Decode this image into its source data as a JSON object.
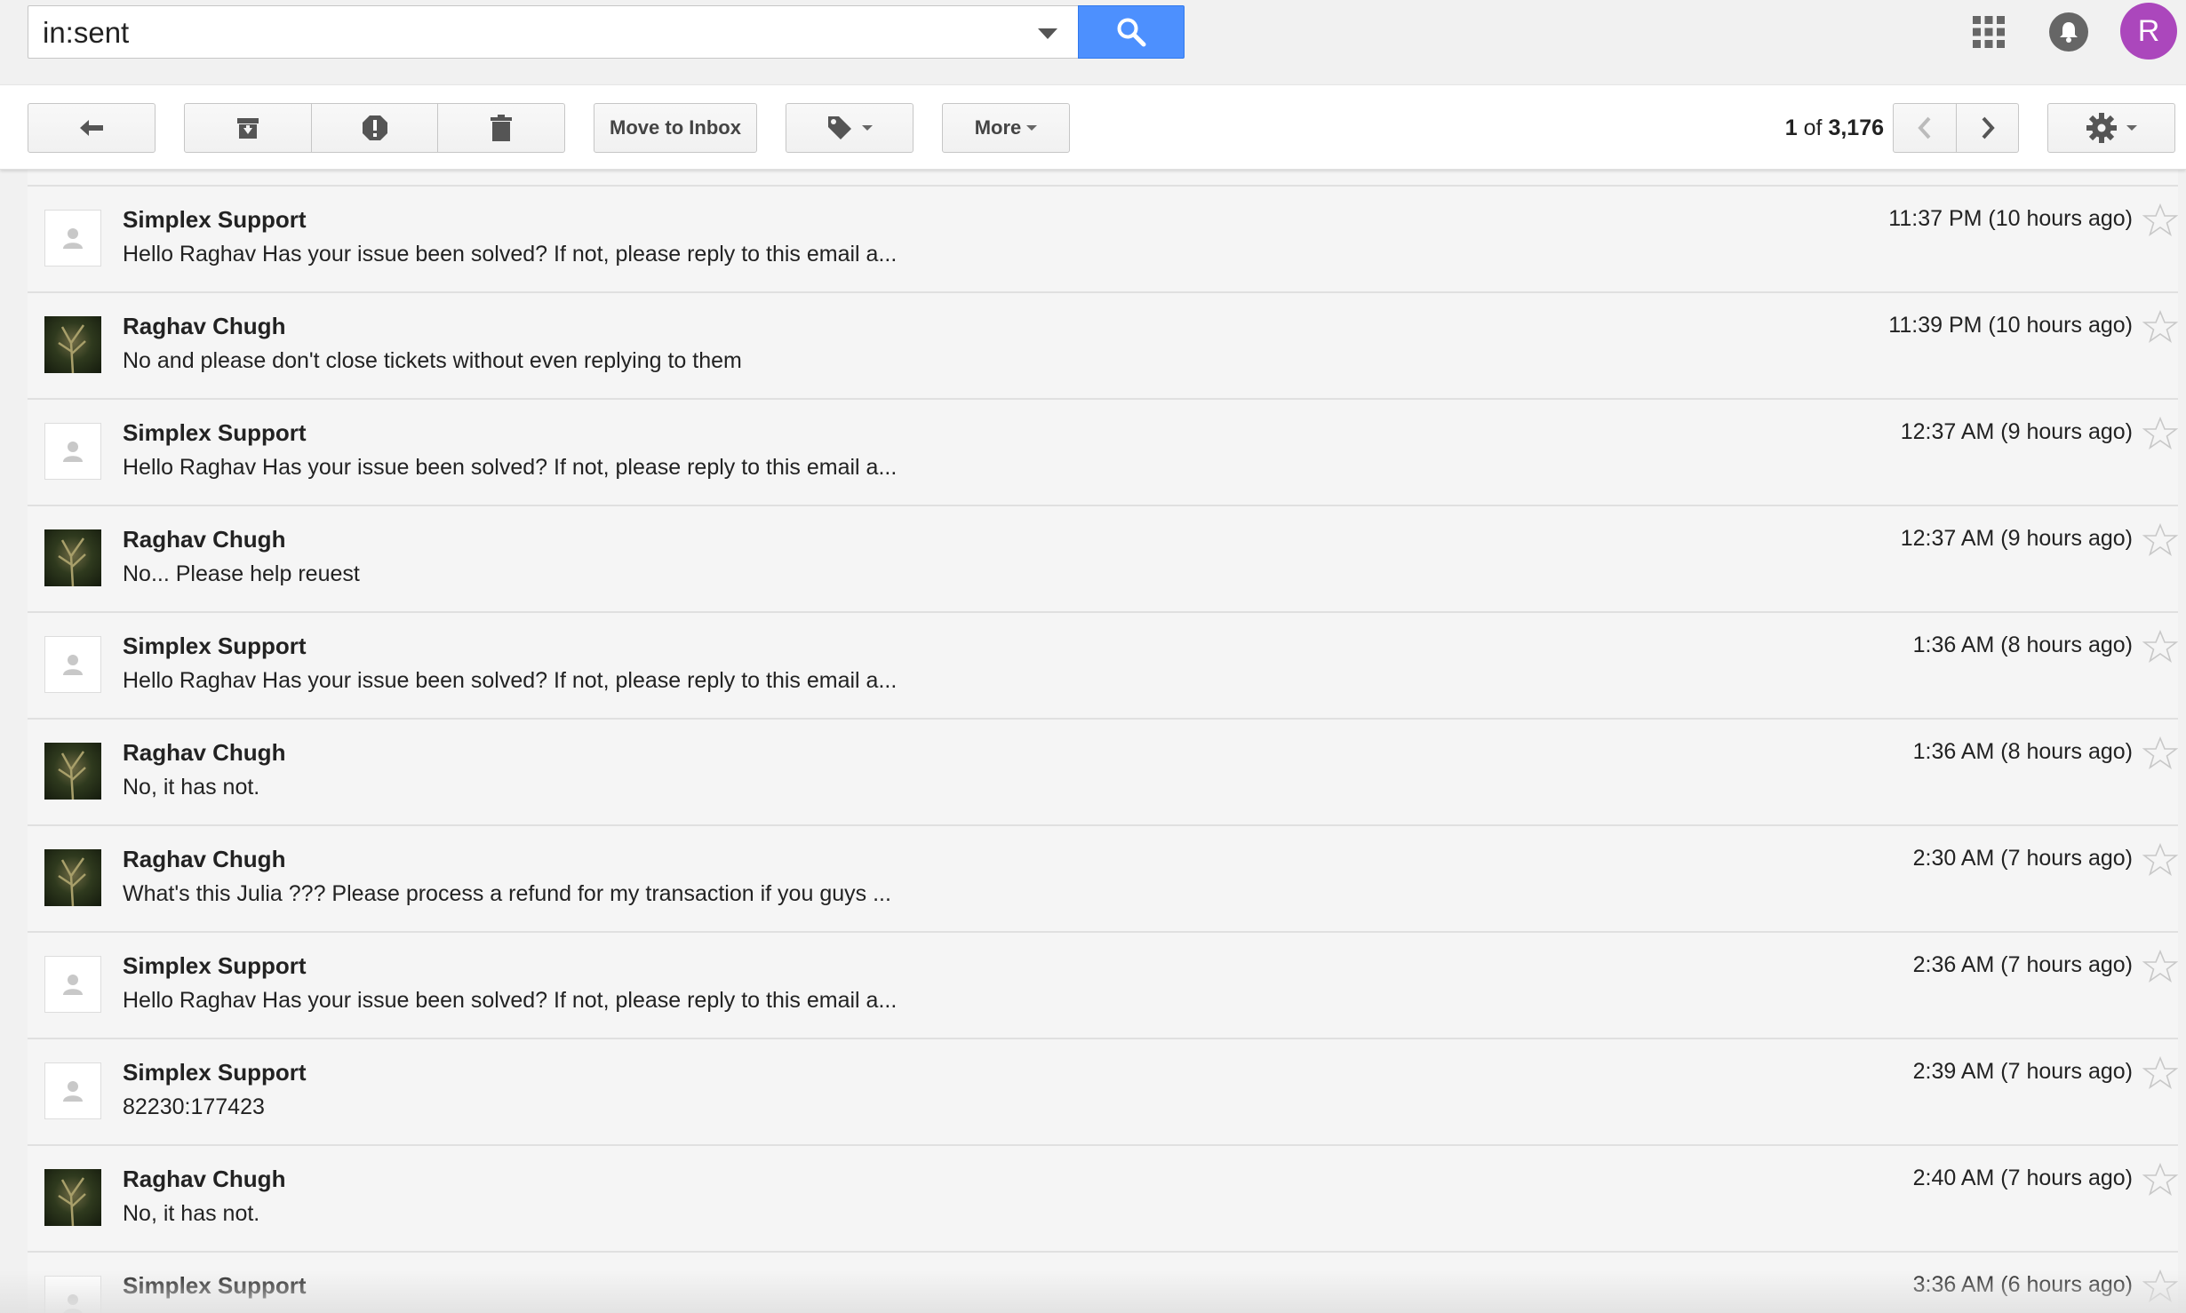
{
  "search": {
    "value": "in:sent"
  },
  "header": {
    "avatar_initial": "R"
  },
  "toolbar": {
    "move_to_inbox_label": "Move to Inbox",
    "more_label": "More",
    "page_current": "1",
    "page_of": " of ",
    "page_total": "3,176"
  },
  "colors": {
    "search_button": "#4d90fe",
    "avatar": "#ab47bc"
  },
  "messages": [
    {
      "sender": "",
      "snippet": "Hello Raghav Has your issue been solved? If not, please reply to this email a...",
      "time": "",
      "avatar": "person-icon"
    },
    {
      "sender": "Simplex Support",
      "snippet": "Hello Raghav Has your issue been solved? If not, please reply to this email a...",
      "time": "11:37 PM (10 hours ago)",
      "avatar": "person-icon"
    },
    {
      "sender": "Raghav Chugh",
      "snippet": "No and please don't close tickets without even replying to them",
      "time": "11:39 PM (10 hours ago)",
      "avatar": "profile-photo"
    },
    {
      "sender": "Simplex Support",
      "snippet": "Hello Raghav Has your issue been solved? If not, please reply to this email a...",
      "time": "12:37 AM (9 hours ago)",
      "avatar": "person-icon"
    },
    {
      "sender": "Raghav Chugh",
      "snippet": "No... Please help reuest",
      "time": "12:37 AM (9 hours ago)",
      "avatar": "profile-photo"
    },
    {
      "sender": "Simplex Support",
      "snippet": "Hello Raghav Has your issue been solved? If not, please reply to this email a...",
      "time": "1:36 AM (8 hours ago)",
      "avatar": "person-icon"
    },
    {
      "sender": "Raghav Chugh",
      "snippet": "No, it has not.",
      "time": "1:36 AM (8 hours ago)",
      "avatar": "profile-photo"
    },
    {
      "sender": "Raghav Chugh",
      "snippet": "What's this Julia ??? Please process a refund for my transaction if you guys ...",
      "time": "2:30 AM (7 hours ago)",
      "avatar": "profile-photo"
    },
    {
      "sender": "Simplex Support",
      "snippet": "Hello Raghav Has your issue been solved? If not, please reply to this email a...",
      "time": "2:36 AM (7 hours ago)",
      "avatar": "person-icon"
    },
    {
      "sender": "Simplex Support",
      "snippet": "82230:177423",
      "time": "2:39 AM (7 hours ago)",
      "avatar": "person-icon"
    },
    {
      "sender": "Raghav Chugh",
      "snippet": "No, it has not.",
      "time": "2:40 AM (7 hours ago)",
      "avatar": "profile-photo"
    },
    {
      "sender": "Simplex Support",
      "snippet": "",
      "time": "3:36 AM (6 hours ago)",
      "avatar": "person-icon"
    }
  ]
}
